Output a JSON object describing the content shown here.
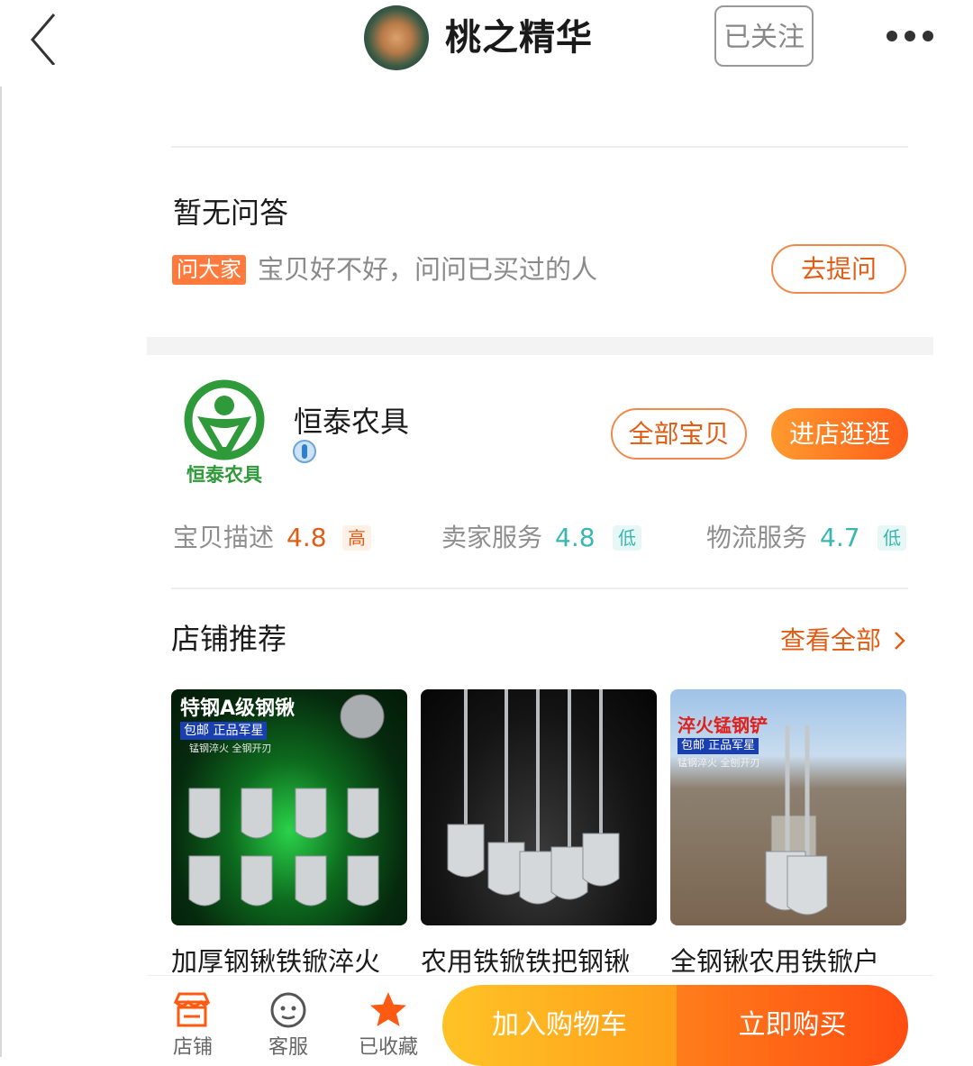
{
  "header": {
    "back_icon": "chevron-left-icon",
    "shop_name": "桃之精华",
    "follow_label": "已关注",
    "more_icon": "more-dots-icon"
  },
  "qa": {
    "title": "暂无问答",
    "tag": "问大家",
    "hint": "宝贝好不好，问问已买过的人",
    "ask_label": "去提问"
  },
  "store": {
    "logo_text": "恒泰农具",
    "name": "恒泰农具",
    "all_items_label": "全部宝贝",
    "enter_label": "进店逛逛",
    "ratings": [
      {
        "label": "宝贝描述",
        "score": "4.8",
        "level": "高"
      },
      {
        "label": "卖家服务",
        "score": "4.8",
        "level": "低"
      },
      {
        "label": "物流服务",
        "score": "4.7",
        "level": "低"
      }
    ],
    "colors": {
      "high": "#e25c14",
      "low": "#37b7b0"
    }
  },
  "recommend": {
    "title": "店铺推荐",
    "view_all": "查看全部",
    "items": [
      {
        "title": "加厚钢锹铁锨淬火",
        "img_caption": "特钢A级钢锹",
        "img_sub": "包邮 正品军星",
        "img_note": "锰钢淬火 全钢开刃"
      },
      {
        "title": "农用铁锨铁把钢锹"
      },
      {
        "title": "全钢锹农用铁锨户",
        "img_caption": "淬火锰钢铲",
        "img_sub": "包邮 正品军星",
        "img_note": "锰钢淬火 全刨开刃"
      }
    ]
  },
  "bottom": {
    "tabs": [
      {
        "label": "店铺",
        "icon": "store-icon"
      },
      {
        "label": "客服",
        "icon": "chat-face-icon"
      },
      {
        "label": "已收藏",
        "icon": "star-icon"
      }
    ],
    "cart_label": "加入购物车",
    "buy_label": "立即购买"
  }
}
